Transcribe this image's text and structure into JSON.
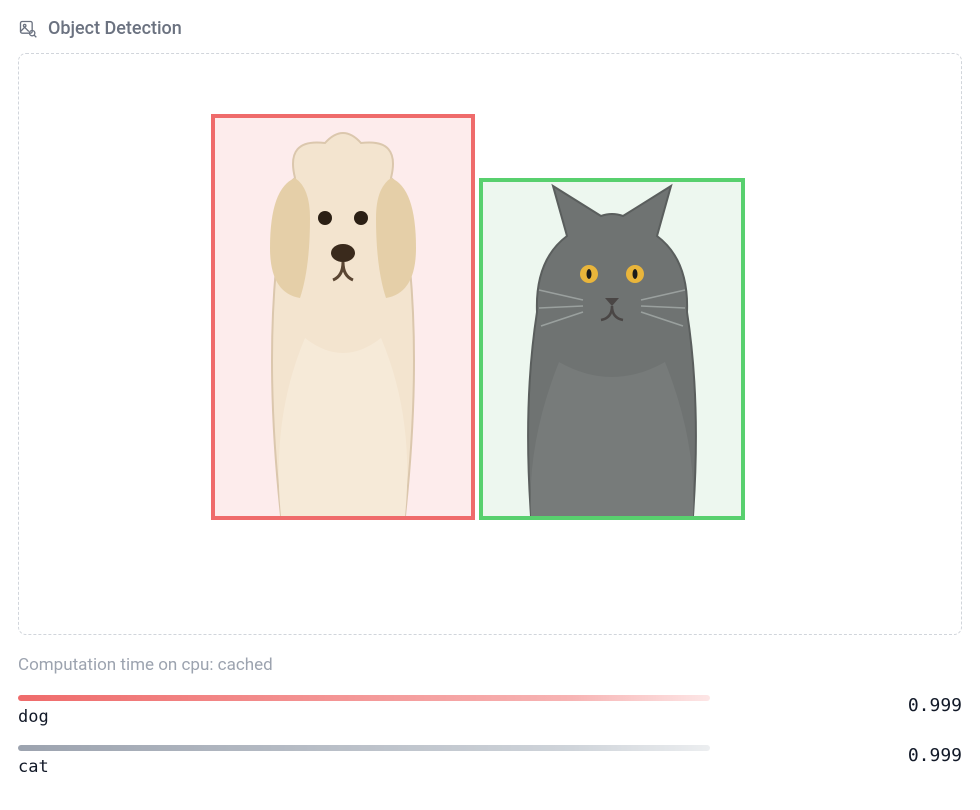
{
  "header": {
    "title": "Object Detection",
    "icon": "image-search-icon"
  },
  "detection": {
    "objects": [
      {
        "label": "dog",
        "box_class": "obj-dog",
        "border_color": "#ef6b6b",
        "fill_color": "#fdecec"
      },
      {
        "label": "cat",
        "box_class": "obj-cat",
        "border_color": "#58d06e",
        "fill_color": "#edf7ef"
      }
    ]
  },
  "status": {
    "text": "Computation time on cpu: cached"
  },
  "results": [
    {
      "label": "dog",
      "score": "0.999",
      "bar_class": "bar-red"
    },
    {
      "label": "cat",
      "score": "0.999",
      "bar_class": "bar-gray"
    }
  ]
}
